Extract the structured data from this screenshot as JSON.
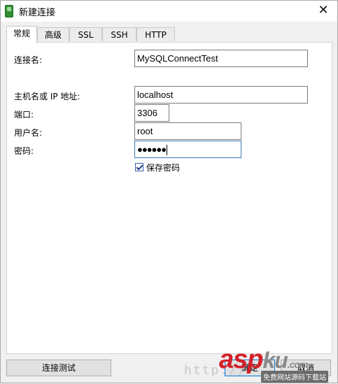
{
  "window": {
    "title": "新建连接",
    "close_glyph": "✕"
  },
  "tabs": [
    {
      "label": "常规",
      "active": true
    },
    {
      "label": "高级",
      "active": false
    },
    {
      "label": "SSL",
      "active": false
    },
    {
      "label": "SSH",
      "active": false
    },
    {
      "label": "HTTP",
      "active": false
    }
  ],
  "form": {
    "conn_name_label": "连接名:",
    "conn_name_value": "MySQLConnectTest",
    "host_label": "主机名或 IP 地址:",
    "host_value": "localhost",
    "port_label": "端口:",
    "port_value": "3306",
    "user_label": "用户名:",
    "user_value": "root",
    "password_label": "密码:",
    "password_value": "●●●●●●",
    "save_password_label": "保存密码",
    "save_password_checked": true
  },
  "buttons": {
    "test_label": "连接测试",
    "ok_label": "确定",
    "cancel_label": "取消"
  },
  "watermark": {
    "url_text": "http://",
    "logo_asp": "asp",
    "logo_ku": "ku",
    "logo_tld": ".com",
    "tagline": "免费网站源码下载站"
  },
  "icons": {
    "app": "navicat-app-icon",
    "check": "checkmark-icon"
  }
}
